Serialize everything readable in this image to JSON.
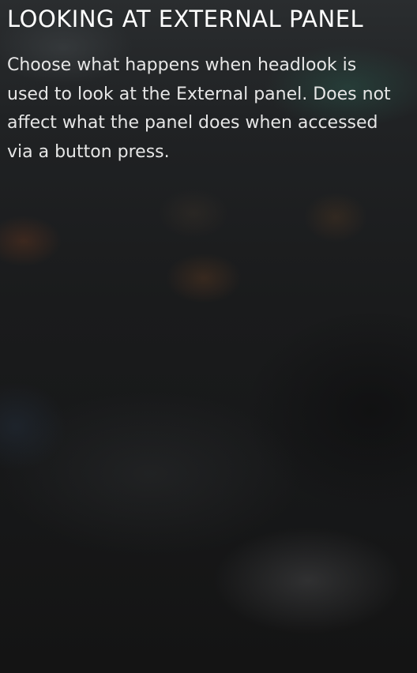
{
  "panel": {
    "title": "LOOKING AT EXTERNAL PANEL",
    "description": "Choose what happens when headlook is used to look at the External panel. Does not affect what the panel does when accessed via a button press."
  }
}
